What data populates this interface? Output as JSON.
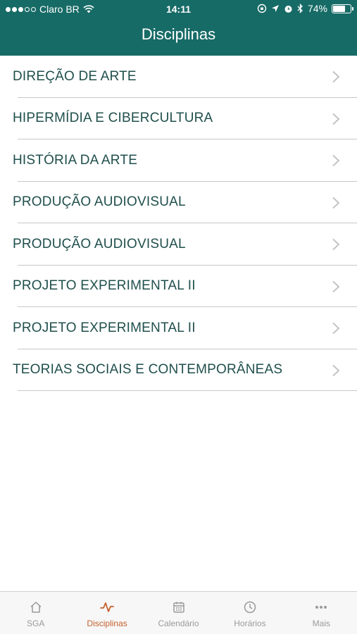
{
  "status_bar": {
    "carrier": "Claro BR",
    "time": "14:11",
    "battery": "74%",
    "battery_level": 0.74
  },
  "nav": {
    "title": "Disciplinas"
  },
  "list": {
    "items": [
      {
        "label": "DIREÇÃO DE ARTE"
      },
      {
        "label": "HIPERMÍDIA E CIBERCULTURA"
      },
      {
        "label": "HISTÓRIA DA ARTE"
      },
      {
        "label": "PRODUÇÃO AUDIOVISUAL"
      },
      {
        "label": "PRODUÇÃO AUDIOVISUAL"
      },
      {
        "label": "PROJETO EXPERIMENTAL II"
      },
      {
        "label": "PROJETO EXPERIMENTAL II"
      },
      {
        "label": "TEORIAS SOCIAIS E CONTEMPORÂNEAS"
      }
    ]
  },
  "tabbar": {
    "tabs": [
      {
        "label": "SGA",
        "icon": "home-icon"
      },
      {
        "label": "Disciplinas",
        "icon": "activity-icon",
        "active": true
      },
      {
        "label": "Calendário",
        "icon": "calendar-icon"
      },
      {
        "label": "Horários",
        "icon": "clock-icon"
      },
      {
        "label": "Mais",
        "icon": "more-icon"
      }
    ]
  },
  "colors": {
    "header": "#176b66",
    "item_text": "#1f4f4c",
    "tab_active": "#c4602c",
    "tab_inactive": "#9a9a9a"
  }
}
